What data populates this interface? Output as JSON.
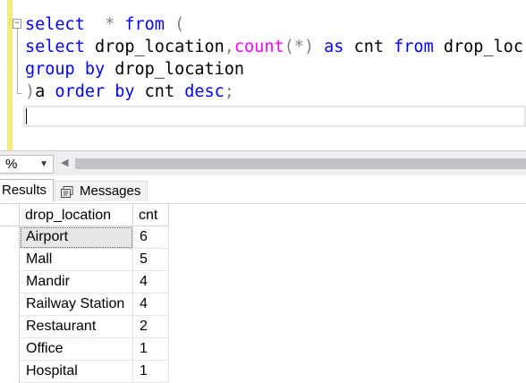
{
  "editor": {
    "lines": [
      [
        {
          "t": "select",
          "c": "kw"
        },
        {
          "t": "  ",
          "c": ""
        },
        {
          "t": "*",
          "c": "op"
        },
        {
          "t": " ",
          "c": ""
        },
        {
          "t": "from",
          "c": "kw"
        },
        {
          "t": " ",
          "c": ""
        },
        {
          "t": "(",
          "c": "op"
        }
      ],
      [
        {
          "t": "select",
          "c": "kw"
        },
        {
          "t": " drop_location",
          "c": ""
        },
        {
          "t": ",",
          "c": "op"
        },
        {
          "t": "count",
          "c": "fn"
        },
        {
          "t": "(*)",
          "c": "op"
        },
        {
          "t": " ",
          "c": ""
        },
        {
          "t": "as",
          "c": "kw"
        },
        {
          "t": " cnt ",
          "c": ""
        },
        {
          "t": "from",
          "c": "kw"
        },
        {
          "t": " drop_loc",
          "c": ""
        }
      ],
      [
        {
          "t": "group by",
          "c": "kw"
        },
        {
          "t": " drop_location",
          "c": ""
        }
      ],
      [
        {
          "t": ")",
          "c": "op"
        },
        {
          "t": "a ",
          "c": ""
        },
        {
          "t": "order by",
          "c": "kw"
        },
        {
          "t": " cnt ",
          "c": ""
        },
        {
          "t": "desc",
          "c": "kw"
        },
        {
          "t": ";",
          "c": "op"
        }
      ]
    ],
    "fold_symbol": "−"
  },
  "status": {
    "zoom_value": "%",
    "zoom_dropdown_icon": "caret-down-icon",
    "scroll_left_icon": "caret-left-icon"
  },
  "tabs": {
    "results_label": "Results",
    "messages_label": "Messages"
  },
  "results": {
    "columns": [
      "drop_location",
      "cnt"
    ],
    "rows": [
      [
        "Airport",
        "6"
      ],
      [
        "Mall",
        "5"
      ],
      [
        "Mandir",
        "4"
      ],
      [
        "Railway Station",
        "4"
      ],
      [
        "Restaurant",
        "2"
      ],
      [
        "Office",
        "1"
      ],
      [
        "Hospital",
        "1"
      ]
    ]
  },
  "colors": {
    "keyword": "#0000ff",
    "function": "#ff00ff",
    "operator": "#808080",
    "change_bar": "#f0ec7e"
  }
}
